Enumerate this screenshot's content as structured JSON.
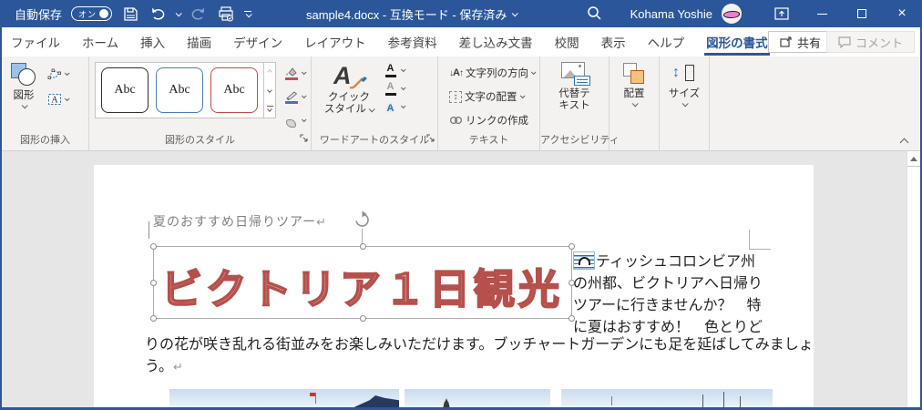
{
  "titlebar": {
    "autosave_label": "自動保存",
    "autosave_state": "オン",
    "title": "sample4.docx  -  互換モード - 保存済み",
    "user_name": "Kohama Yoshie"
  },
  "tabrow": {
    "tabs": [
      "ファイル",
      "ホーム",
      "挿入",
      "描画",
      "デザイン",
      "レイアウト",
      "参考資料",
      "差し込み文書",
      "校閲",
      "表示",
      "ヘルプ",
      "図形の書式"
    ],
    "active_tab": "図形の書式",
    "share": "共有",
    "comment": "コメント"
  },
  "ribbon": {
    "insert_shapes": {
      "shapes_button": "図形",
      "group_label": "図形の挿入"
    },
    "shape_styles": {
      "sample": "Abc",
      "group_label": "図形のスタイル"
    },
    "wordart_styles": {
      "quick_style_line1": "クイック",
      "quick_style_line2": "スタイル",
      "group_label": "ワードアートのスタイル"
    },
    "text_group": {
      "direction": "文字列の方向",
      "align": "文字の配置",
      "link": "リンクの作成",
      "group_label": "テキスト"
    },
    "accessibility": {
      "alt_text": "代替テキスト",
      "group_label": "アクセシビリティ"
    },
    "arrange": {
      "button": "配置"
    },
    "size": {
      "button": "サイズ"
    }
  },
  "document": {
    "heading": "夏のおすすめ日帰りツアー",
    "pilcrow": "↵",
    "wordart": "ビクトリア１日観光",
    "wrap_lines": [
      "ティッシュコロンビア州",
      "の州都、ビクトリアへ日帰り",
      "ツアーに行きませんか？　特",
      "に夏はおすすめ！　色とりど"
    ],
    "full_lines": [
      "りの花が咲き乱れる街並みをお楽しみいただけます。ブッチャートガーデンにも足を延ばしてみましょ",
      "う。"
    ]
  },
  "colors": {
    "accent": "#2b579a",
    "wordart_fill": "#f2aba9",
    "wordart_stroke": "#b5504c"
  }
}
